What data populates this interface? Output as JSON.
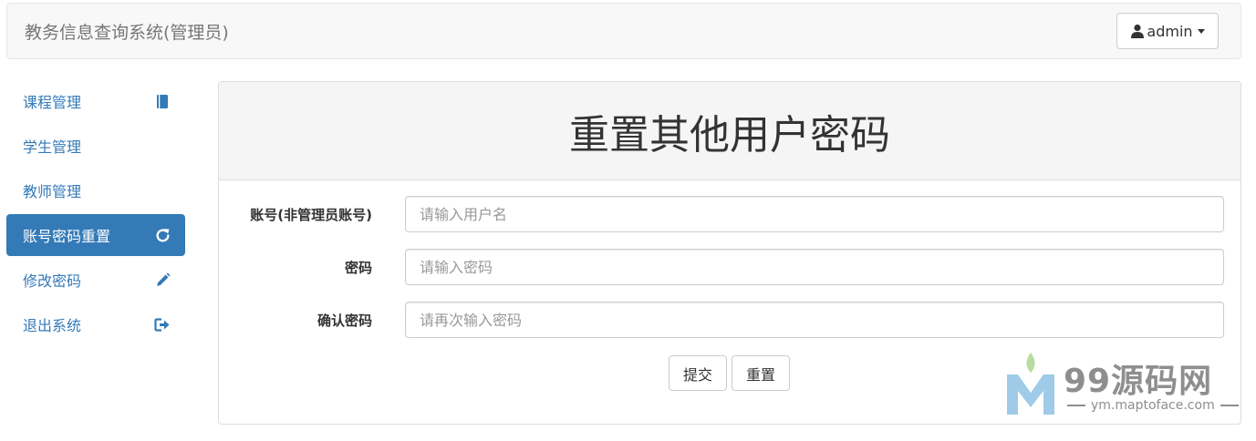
{
  "navbar": {
    "brand": "教务信息查询系统(管理员)",
    "user_label": "admin"
  },
  "sidebar": {
    "items": [
      {
        "label": "课程管理",
        "icon": "book-icon"
      },
      {
        "label": "学生管理",
        "icon": ""
      },
      {
        "label": "教师管理",
        "icon": ""
      },
      {
        "label": "账号密码重置",
        "icon": "refresh-icon",
        "active": true
      },
      {
        "label": "修改密码",
        "icon": "pencil-icon"
      },
      {
        "label": "退出系统",
        "icon": "logout-icon"
      }
    ]
  },
  "main": {
    "title": "重置其他用户密码",
    "fields": [
      {
        "label": "账号(非管理员账号)",
        "placeholder": "请输入用户名",
        "value": ""
      },
      {
        "label": "密码",
        "placeholder": "请输入密码",
        "value": ""
      },
      {
        "label": "确认密码",
        "placeholder": "请再次输入密码",
        "value": ""
      }
    ],
    "submit_label": "提交",
    "reset_label": "重置"
  },
  "watermark": {
    "name": "99源码网",
    "url": "ym.maptoface.com"
  },
  "colors": {
    "primary": "#337ab7",
    "navbar_bg": "#f8f8f8",
    "panel_heading_bg": "#f5f5f5"
  }
}
